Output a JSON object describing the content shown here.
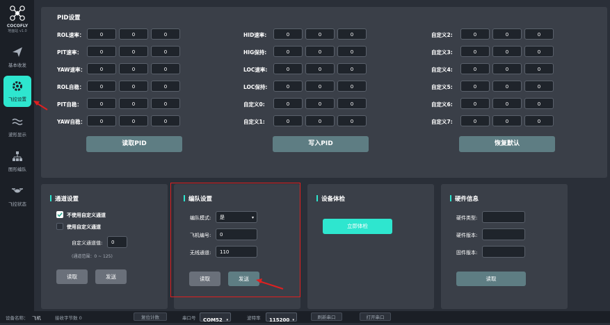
{
  "app": {
    "name": "COCOFLY",
    "version": "地面站 v1.0"
  },
  "nav": [
    {
      "label": "基本收发",
      "icon": "send-icon"
    },
    {
      "label": "飞控设置",
      "icon": "gear-icon",
      "active": true
    },
    {
      "label": "波形显示",
      "icon": "wave-icon"
    },
    {
      "label": "图形编队",
      "icon": "formation-icon"
    },
    {
      "label": "飞控状态",
      "icon": "drone-icon"
    }
  ],
  "pid": {
    "title": "PID设置",
    "col1": [
      {
        "label": "ROL速率：",
        "values": [
          "0",
          "0",
          "0"
        ]
      },
      {
        "label": "PIT速率：",
        "values": [
          "0",
          "0",
          "0"
        ]
      },
      {
        "label": "YAW速率：",
        "values": [
          "0",
          "0",
          "0"
        ]
      },
      {
        "label": "ROL自稳：",
        "values": [
          "0",
          "0",
          "0"
        ]
      },
      {
        "label": "PIT自稳：",
        "values": [
          "0",
          "0",
          "0"
        ]
      },
      {
        "label": "YAW自稳：",
        "values": [
          "0",
          "0",
          "0"
        ]
      }
    ],
    "col2": [
      {
        "label": "HID速率:",
        "values": [
          "0",
          "0",
          "0"
        ]
      },
      {
        "label": "HIG保持:",
        "values": [
          "0",
          "0",
          "0"
        ]
      },
      {
        "label": "LOC速率:",
        "values": [
          "0",
          "0",
          "0"
        ]
      },
      {
        "label": "LOC保持:",
        "values": [
          "0",
          "0",
          "0"
        ]
      },
      {
        "label": "自定义0:",
        "values": [
          "0",
          "0",
          "0"
        ]
      },
      {
        "label": "自定义1:",
        "values": [
          "0",
          "0",
          "0"
        ]
      }
    ],
    "col3": [
      {
        "label": "自定义2:",
        "values": [
          "0",
          "0",
          "0"
        ]
      },
      {
        "label": "自定义3:",
        "values": [
          "0",
          "0",
          "0"
        ]
      },
      {
        "label": "自定义4:",
        "values": [
          "0",
          "0",
          "0"
        ]
      },
      {
        "label": "自定义5:",
        "values": [
          "0",
          "0",
          "0"
        ]
      },
      {
        "label": "自定义6:",
        "values": [
          "0",
          "0",
          "0"
        ]
      },
      {
        "label": "自定义7:",
        "values": [
          "0",
          "0",
          "0"
        ]
      }
    ],
    "read_btn": "读取PID",
    "write_btn": "写入PID",
    "reset_btn": "恢复默认"
  },
  "channel": {
    "title": "通道设置",
    "opt1": "不使用自定义通道",
    "opt2": "使用自定义通道",
    "custom_label": "自定义通道值:",
    "custom_value": "0",
    "range_note": "(通道范围：0 ~ 125)",
    "read_btn": "读取",
    "send_btn": "发送"
  },
  "formation": {
    "title": "编队设置",
    "mode_label": "编队模式:",
    "mode_value": "是",
    "num_label": "飞机编号:",
    "num_value": "0",
    "wireless_label": "无线通道:",
    "wireless_value": "110",
    "read_btn": "读取",
    "send_btn": "发送"
  },
  "check": {
    "title": "设备体检",
    "btn": "立即体检"
  },
  "hw": {
    "title": "硬件信息",
    "type_label": "硬件类型:",
    "ver_label": "硬件版本:",
    "fw_label": "固件版本:",
    "read_btn": "读取"
  },
  "status": {
    "device_label": "设备名称：",
    "device_value": "飞机",
    "bytes_label": "接收字节数 0",
    "reset_btn": "复位计数",
    "port_label": "串口号",
    "port_value": "COM52",
    "baud_label": "波特率",
    "baud_value": "115200",
    "refresh_btn": "刷新串口",
    "open_btn": "打开串口"
  },
  "colors": {
    "accent": "#2ee6cf",
    "annotation": "#e02020"
  }
}
